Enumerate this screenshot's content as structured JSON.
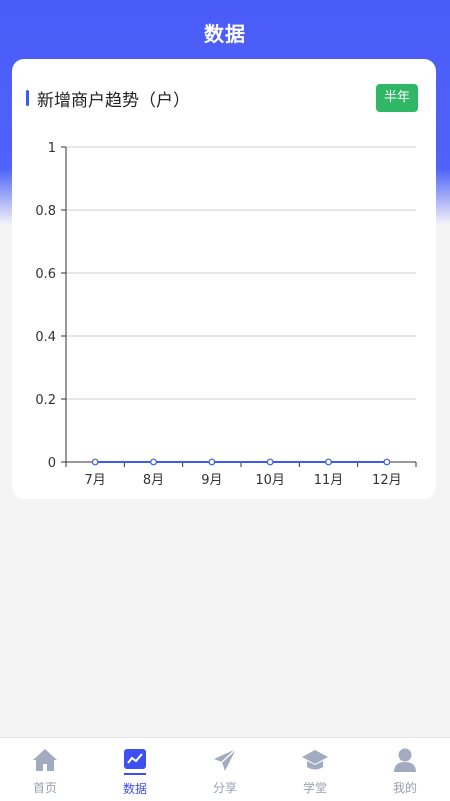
{
  "header": {
    "title": "数据"
  },
  "card": {
    "title": "新增商户趋势（户）",
    "range_button": "半年"
  },
  "chart_data": {
    "type": "line",
    "title": "新增商户趋势（户）",
    "categories": [
      "7月",
      "8月",
      "9月",
      "10月",
      "11月",
      "12月"
    ],
    "series": [
      {
        "values": [
          0,
          0,
          0,
          0,
          0,
          0
        ]
      }
    ],
    "y_ticks": [
      0,
      0.2,
      0.4,
      0.6,
      0.8,
      1
    ],
    "ylim": [
      0,
      1
    ],
    "grid": true,
    "line_color": "#3d5af1"
  },
  "tabbar": {
    "items": [
      {
        "label": "首页",
        "icon": "home-icon",
        "active": false
      },
      {
        "label": "数据",
        "icon": "chart-icon",
        "active": true
      },
      {
        "label": "分享",
        "icon": "send-icon",
        "active": false
      },
      {
        "label": "学堂",
        "icon": "graduation-cap-icon",
        "active": false
      },
      {
        "label": "我的",
        "icon": "user-icon",
        "active": false
      }
    ]
  },
  "colors": {
    "accent": "#3d4ff0",
    "header": "#4a5cf8",
    "button": "#2fb766"
  }
}
